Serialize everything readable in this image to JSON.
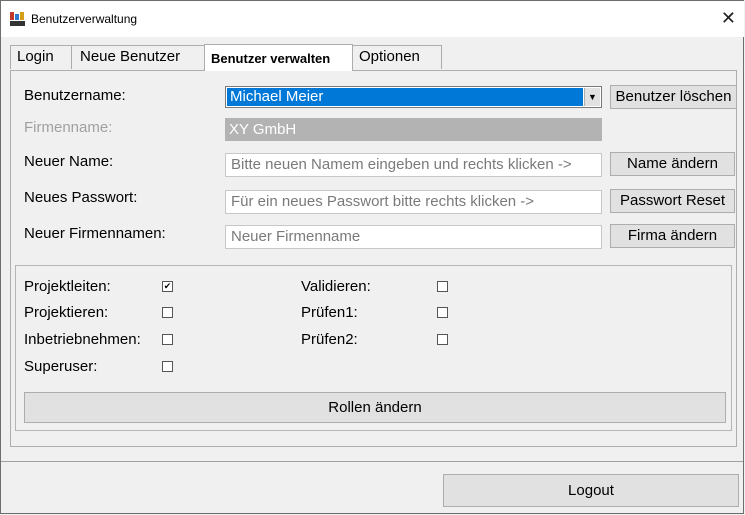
{
  "window": {
    "title": "Benutzerverwaltung",
    "close_glyph": "✕"
  },
  "tabs": [
    {
      "label": "Login"
    },
    {
      "label": "Neue Benutzer"
    },
    {
      "label": "Benutzer verwalten",
      "active": true
    },
    {
      "label": "Optionen"
    }
  ],
  "form": {
    "username_label": "Benutzername:",
    "username_value": "Michael Meier",
    "delete_button": "Benutzer löschen",
    "company_label": "Firmenname:",
    "company_value": "XY GmbH",
    "new_name_label": "Neuer Name:",
    "new_name_placeholder": "Bitte neuen Namem eingeben und rechts klicken ->",
    "rename_button": "Name ändern",
    "new_password_label": "Neues Passwort:",
    "new_password_placeholder": "Für ein neues Passwort bitte rechts klicken ->",
    "password_reset_button": "Passwort Reset",
    "new_company_label": "Neuer Firmennamen:",
    "new_company_placeholder": "Neuer Firmenname",
    "company_change_button": "Firma ändern"
  },
  "roles": {
    "items": [
      {
        "label": "Projektleiten:",
        "checked": true
      },
      {
        "label": "Projektieren:",
        "checked": false
      },
      {
        "label": "Inbetriebnehmen:",
        "checked": false
      },
      {
        "label": "Superuser:",
        "checked": false
      },
      {
        "label": "Validieren:",
        "checked": false
      },
      {
        "label": "Prüfen1:",
        "checked": false
      },
      {
        "label": "Prüfen2:",
        "checked": false
      }
    ],
    "change_button": "Rollen ändern"
  },
  "logout_button": "Logout",
  "colors": {
    "selection": "#0078d7",
    "readonly_field": "#b3b3b3"
  }
}
